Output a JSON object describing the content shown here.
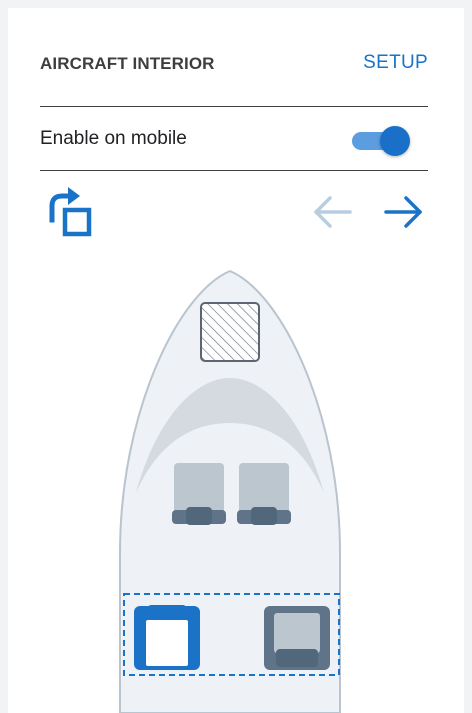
{
  "header": {
    "title": "AIRCRAFT INTERIOR",
    "setup_label": "SETUP"
  },
  "settings": {
    "enable_mobile_label": "Enable on mobile",
    "enable_mobile_on": true
  },
  "toolbar": {
    "rotate_icon": "rotate-icon",
    "prev_icon": "arrow-left-icon",
    "next_icon": "arrow-right-icon",
    "prev_enabled": false,
    "next_enabled": true
  },
  "cabin": {
    "selected_seat": "front-row-left",
    "colors": {
      "accent": "#1a73c6",
      "fuselage_fill": "#eef1f5",
      "fuselage_stroke": "#b9c4cf",
      "seat_fill": "#bcc6cf",
      "seat_dark": "#5f7488"
    }
  }
}
